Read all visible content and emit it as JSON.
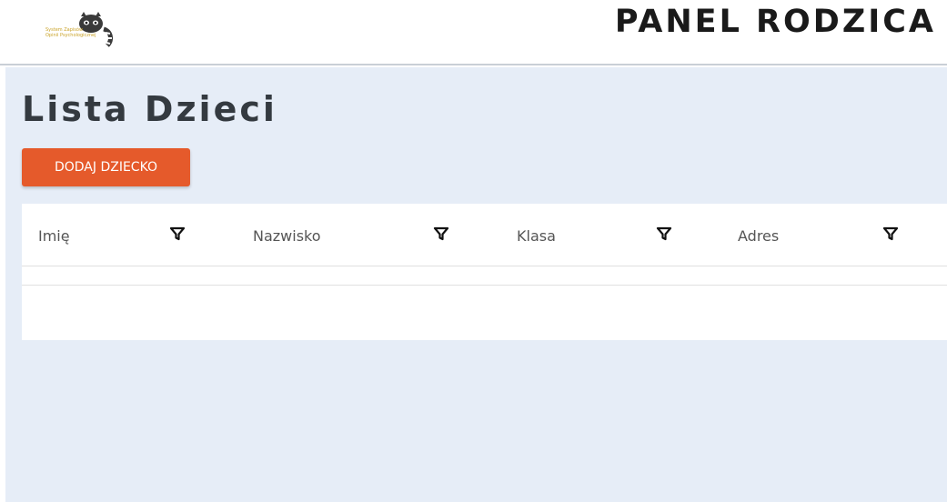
{
  "header": {
    "logo_text_line1": "System Zapisów",
    "logo_text_line2": "Opinii Psychologicznej",
    "title": "PANEL RODZICA"
  },
  "main": {
    "title": "Lista Dzieci",
    "add_button_label": "DODAJ DZIECKO"
  },
  "table": {
    "columns": [
      {
        "label": "Imię",
        "filter_icon": "filter-icon"
      },
      {
        "label": "Nazwisko",
        "filter_icon": "filter-icon"
      },
      {
        "label": "Klasa",
        "filter_icon": "filter-icon"
      },
      {
        "label": "Adres",
        "filter_icon": "filter-icon"
      }
    ],
    "rows": []
  },
  "colors": {
    "accent": "#e55a2b",
    "background": "#e6edf7",
    "title": "#343a40"
  }
}
